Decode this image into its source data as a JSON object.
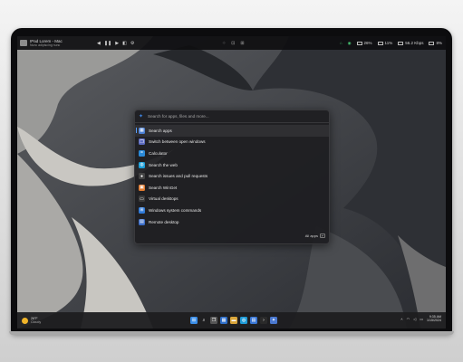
{
  "topbar": {
    "app_title": "IPad Lorem - Mac",
    "app_subtitle": "Nunc adipiscing nunc",
    "media_controls": [
      "prev-icon",
      "play-icon",
      "next-icon",
      "volume-icon",
      "settings-icon"
    ],
    "stats": [
      {
        "name": "cpu",
        "value": "26%"
      },
      {
        "name": "memory",
        "value": "11%"
      },
      {
        "name": "network",
        "value": "56.2 Kbps"
      },
      {
        "name": "disk",
        "value": "8%"
      }
    ]
  },
  "launcher": {
    "search_placeholder": "Search for apps, files and more...",
    "results": [
      {
        "label": "Search apps",
        "icon": "search-apps-icon",
        "color": "#4a7fd4",
        "glyph": "▦",
        "selected": true
      },
      {
        "label": "Switch between open windows",
        "icon": "windows-icon",
        "color": "#5c6bc0",
        "glyph": "❐",
        "selected": false
      },
      {
        "label": "Calculator",
        "icon": "calculator-icon",
        "color": "#2b8ad8",
        "glyph": "=",
        "selected": false
      },
      {
        "label": "Search the web",
        "icon": "globe-icon",
        "color": "#1c9fd8",
        "glyph": "◍",
        "selected": false
      },
      {
        "label": "Search issues and pull requests",
        "icon": "github-icon",
        "color": "#444444",
        "glyph": "●",
        "selected": false
      },
      {
        "label": "Search WinGet",
        "icon": "package-icon",
        "color": "#e07a2f",
        "glyph": "▣",
        "selected": false
      },
      {
        "label": "Virtual desktops",
        "icon": "desktop-icon",
        "color": "#3a3a3a",
        "glyph": "▭",
        "selected": false
      },
      {
        "label": "Windows system commands",
        "icon": "windows-logo-icon",
        "color": "#2f7ad8",
        "glyph": "⊞",
        "selected": false
      },
      {
        "label": "Remote desktop",
        "icon": "remote-desktop-icon",
        "color": "#3c6ec9",
        "glyph": "▤",
        "selected": false
      }
    ],
    "footer_label": "All apps"
  },
  "taskbar": {
    "weather_temp": "26°F",
    "weather_cond": "Cloudy",
    "apps": [
      {
        "name": "start",
        "color": "#3b8ee8",
        "glyph": "⊞"
      },
      {
        "name": "search",
        "color": "transparent",
        "glyph": "⌕"
      },
      {
        "name": "task-view",
        "color": "#555",
        "glyph": "❐"
      },
      {
        "name": "widgets",
        "color": "#2f6fc9",
        "glyph": "▦"
      },
      {
        "name": "file-explorer",
        "color": "#d9a53a",
        "glyph": "▬"
      },
      {
        "name": "edge",
        "color": "#1f9cd8",
        "glyph": "◍"
      },
      {
        "name": "store",
        "color": "#3a77d6",
        "glyph": "▤"
      },
      {
        "name": "terminal",
        "color": "#2a2a2a",
        "glyph": "›"
      },
      {
        "name": "run",
        "color": "#4a78d0",
        "glyph": "✦"
      }
    ],
    "time": "9:35 AM",
    "date": "1/15/2024"
  }
}
